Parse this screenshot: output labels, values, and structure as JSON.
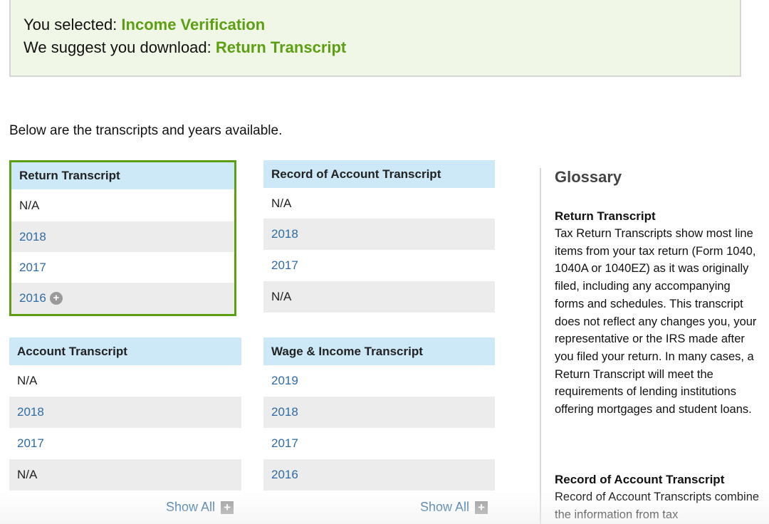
{
  "notice": {
    "selected_prefix": "You selected: ",
    "selected_value": "Income Verification",
    "suggest_prefix": "We suggest you download: ",
    "suggest_value": "Return Transcript"
  },
  "intro": "Below are the transcripts and years available.",
  "cards": {
    "return": {
      "title": "Return Transcript",
      "rows": [
        "N/A",
        "2018",
        "2017",
        "2016"
      ]
    },
    "record": {
      "title": "Record of Account Transcript",
      "rows": [
        "N/A",
        "2018",
        "2017",
        "N/A"
      ]
    },
    "account": {
      "title": "Account Transcript",
      "rows": [
        "N/A",
        "2018",
        "2017",
        "N/A"
      ],
      "show_all": "Show All"
    },
    "wage": {
      "title": "Wage & Income Transcript",
      "rows": [
        "2019",
        "2018",
        "2017",
        "2016"
      ],
      "show_all": "Show All"
    }
  },
  "glossary": {
    "title": "Glossary",
    "term1": "Return Transcript",
    "def1": "Tax Return Transcripts show most line items from your tax return (Form 1040, 1040A or 1040EZ) as it was originally filed, including any accompanying forms and schedules. This transcript does not reflect any changes you, your representative or the IRS made after you filed your return. In many cases, a Return Transcript will meet the requirements of lending institutions offering mortgages and student loans.",
    "term2": "Record of Account Transcript",
    "def2": "Record of Account Transcripts combine the information from tax"
  },
  "colors": {
    "accent_green": "#5c9f12",
    "header_blue": "#cde9f8",
    "link_blue": "#2f6ca5"
  },
  "icons": {
    "expand_row": "plus-circle-icon",
    "show_all": "plus-square-icon"
  }
}
